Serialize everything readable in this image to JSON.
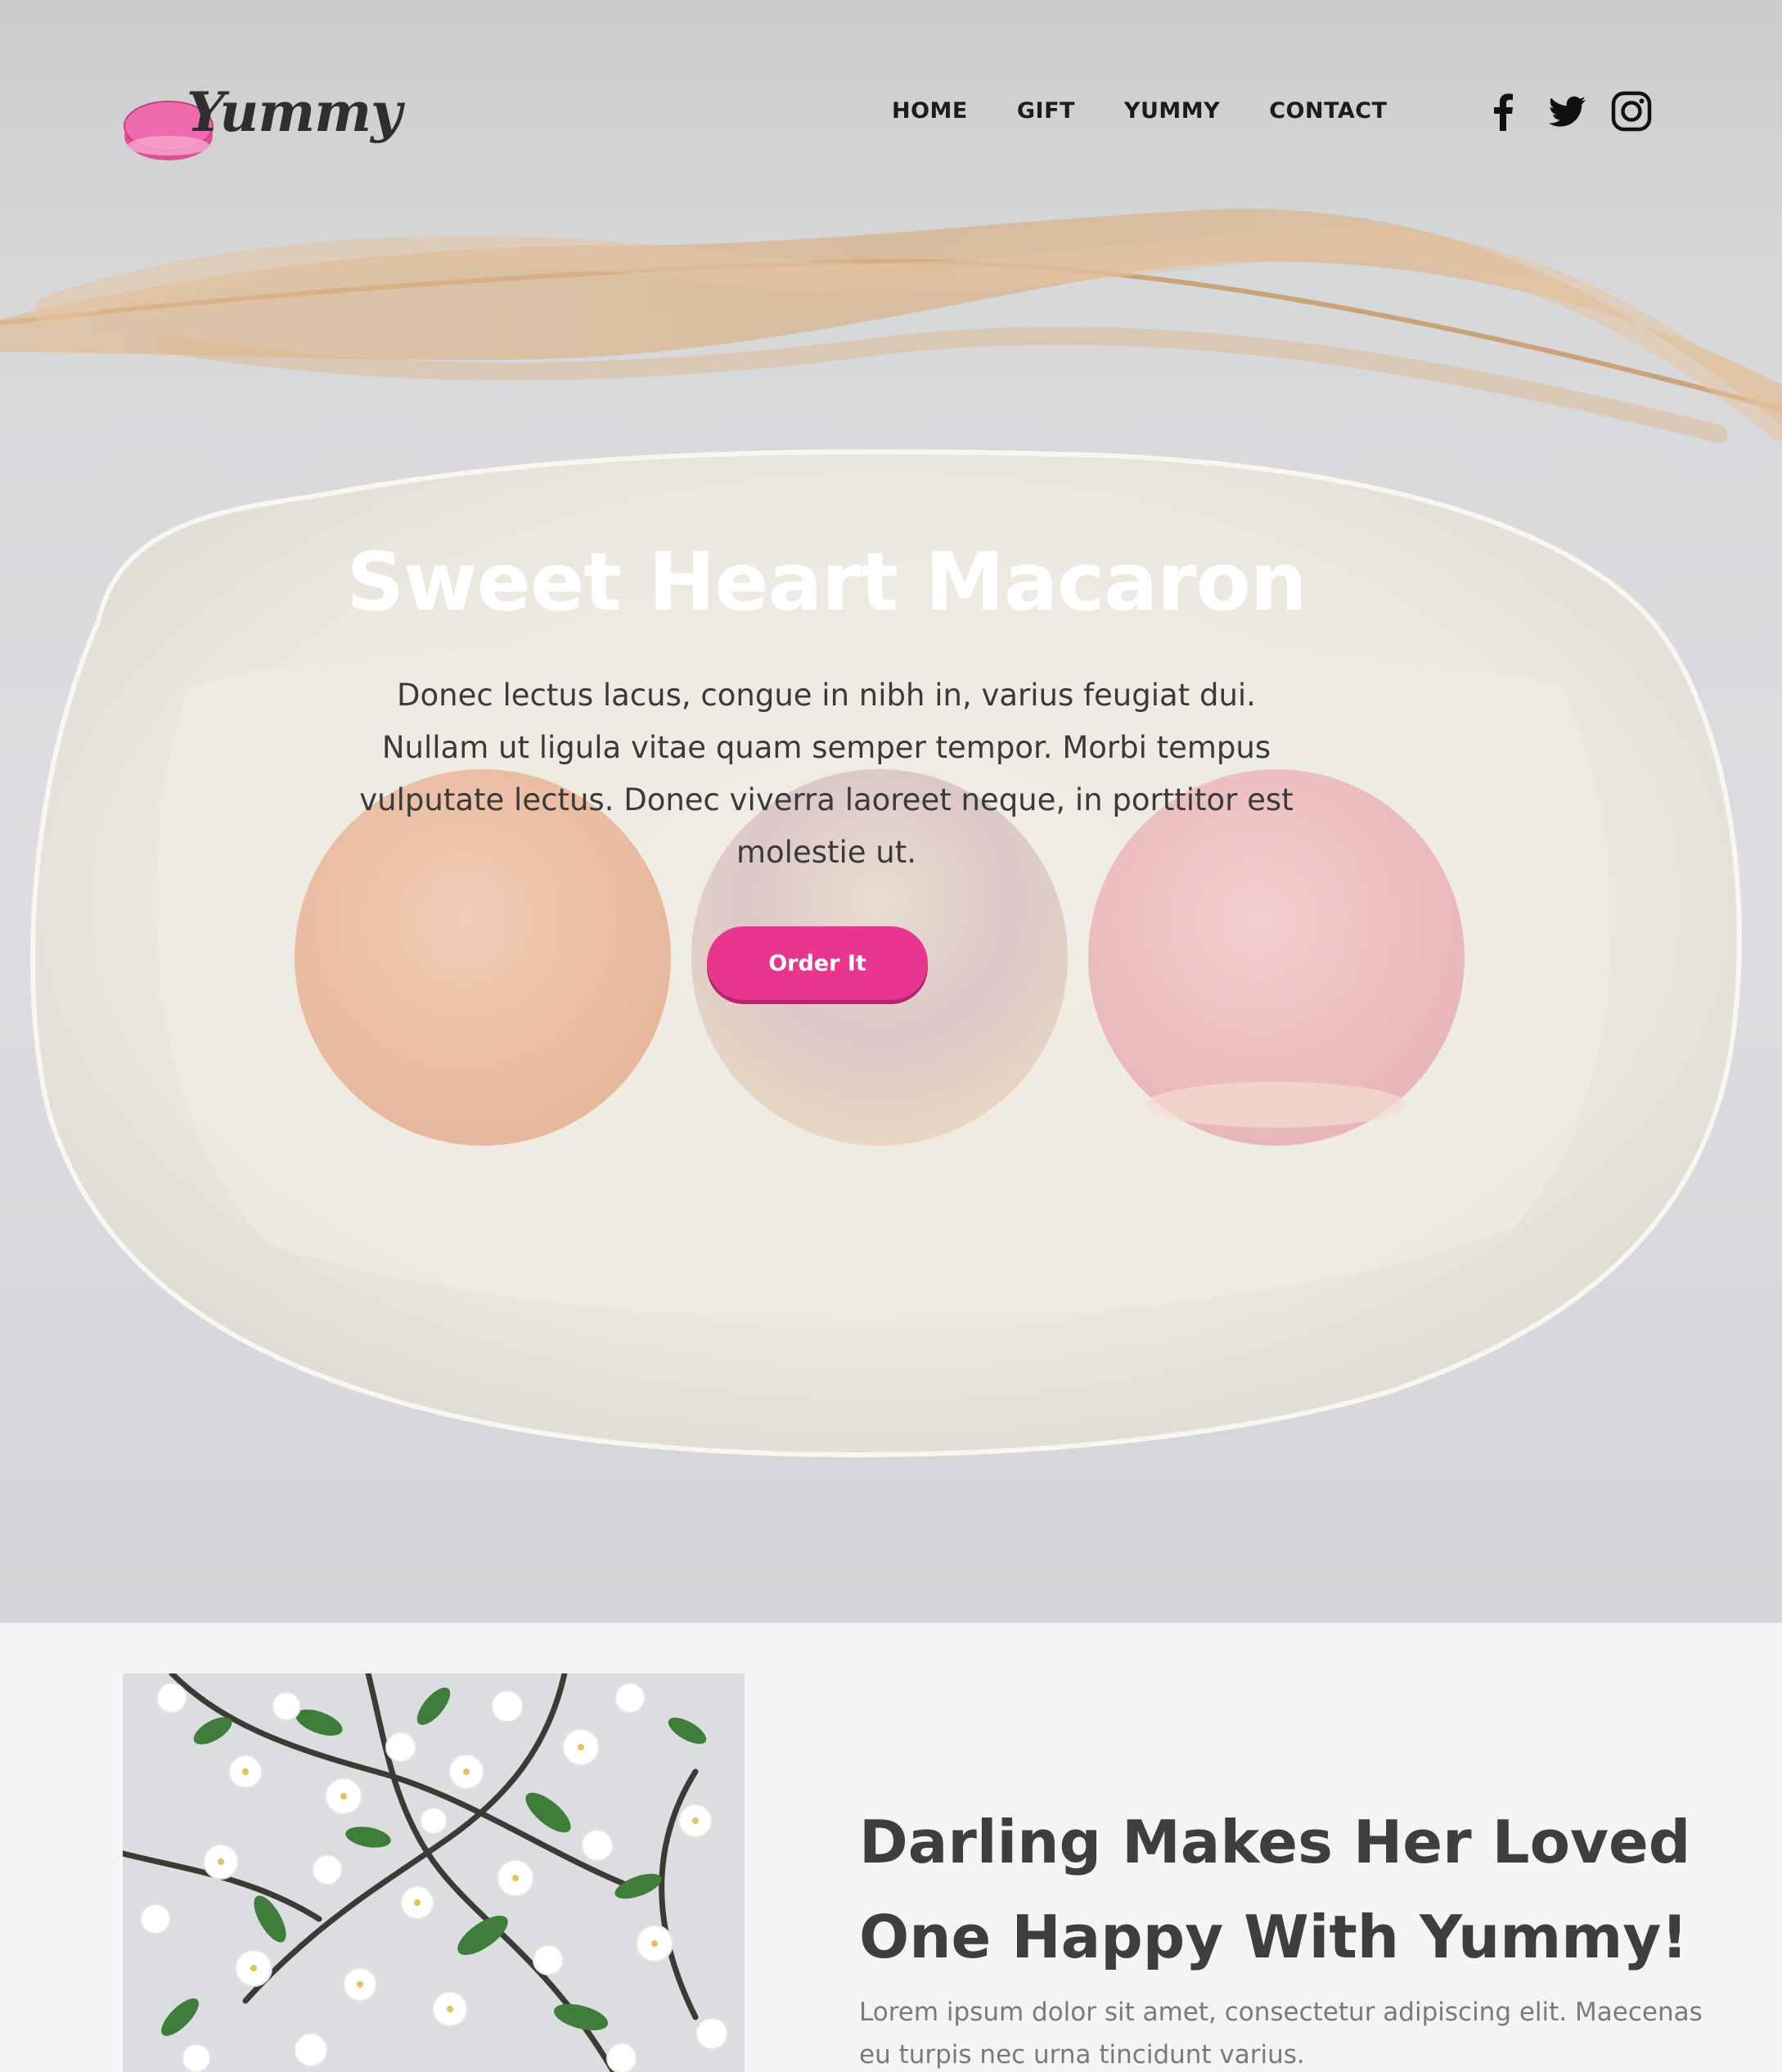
{
  "brand": {
    "logo_text": "Yummy",
    "accent_color": "#e8358d"
  },
  "nav": {
    "items": [
      {
        "label": "HOME"
      },
      {
        "label": "GIFT"
      },
      {
        "label": "YUMMY"
      },
      {
        "label": "CONTACT"
      }
    ]
  },
  "social": {
    "icons": [
      "facebook-icon",
      "twitter-icon",
      "instagram-icon"
    ]
  },
  "hero": {
    "title": "Sweet Heart Macaron",
    "text": "Donec lectus lacus, congue in nibh in, varius feugiat dui. Nullam ut ligula vitae quam semper tempor. Morbi tempus vulputate lectus. Donec viverra laoreet neque, in porttitor est molestie ut.",
    "button_label": "Order It"
  },
  "feature": {
    "title": "Darling Makes Her Loved One Happy With Yummy!",
    "text": "Lorem ipsum dolor sit amet, consectetur adipiscing elit. Maecenas eu turpis nec urna tincidunt varius."
  }
}
